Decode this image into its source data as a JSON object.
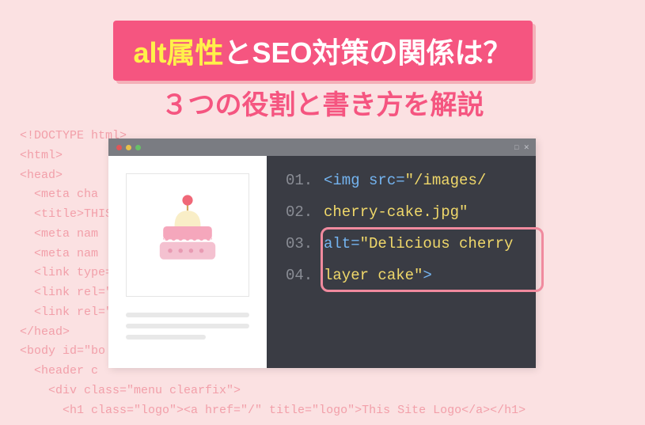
{
  "title": {
    "highlight": "alt属性",
    "rest": "とSEO対策の関係は？"
  },
  "subtitle": "３つの役割と書き方を解説",
  "bg_code": "<!DOCTYPE html>\n<html>\n<head>\n  <meta cha\n  <title>THIS\n  <meta nam                                                                                                rtant for SEO\">\n  <meta nam\n  <link type=\n  <link rel=\"                                                                                                  news.rss\">\n  <link rel=\"                                                                                                 l\">\n</head>\n<body id=\"bo\n  <header c\n    <div class=\"menu clearfix\">\n      <h1 class=\"logo\"><a href=\"/\" title=\"logo\">This Site Logo</a></h1>",
  "browser": {
    "controls": {
      "min": "□",
      "close": "✕"
    }
  },
  "code": {
    "l1_num": "01.",
    "l1_a": "<img ",
    "l1_b": "src=",
    "l1_c": "\"/images/",
    "l2_num": "02.",
    "l2_a": "cherry-cake.jpg\"",
    "l3_num": "03.",
    "l3_a": "alt=",
    "l3_b": "\"Delicious cherry",
    "l4_num": "04.",
    "l4_a": "layer cake\"",
    "l4_b": ">"
  }
}
